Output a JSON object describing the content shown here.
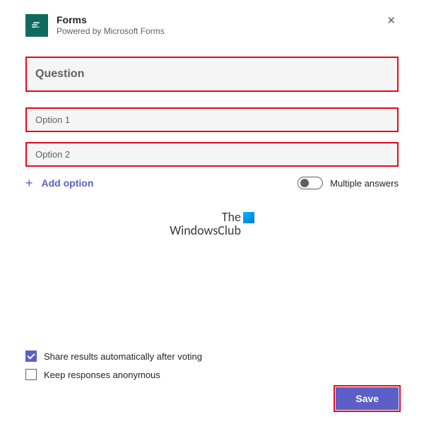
{
  "header": {
    "title": "Forms",
    "subtitle": "Powered by Microsoft Forms"
  },
  "question": {
    "placeholder": "Question"
  },
  "options": [
    {
      "placeholder": "Option 1"
    },
    {
      "placeholder": "Option 2"
    }
  ],
  "add_option_label": "Add option",
  "multiple_answers_label": "Multiple answers",
  "watermark": {
    "line1": "The",
    "line2": "WindowsClub"
  },
  "checkboxes": {
    "share_results": "Share results automatically after voting",
    "keep_anonymous": "Keep responses anonymous"
  },
  "save_label": "Save"
}
